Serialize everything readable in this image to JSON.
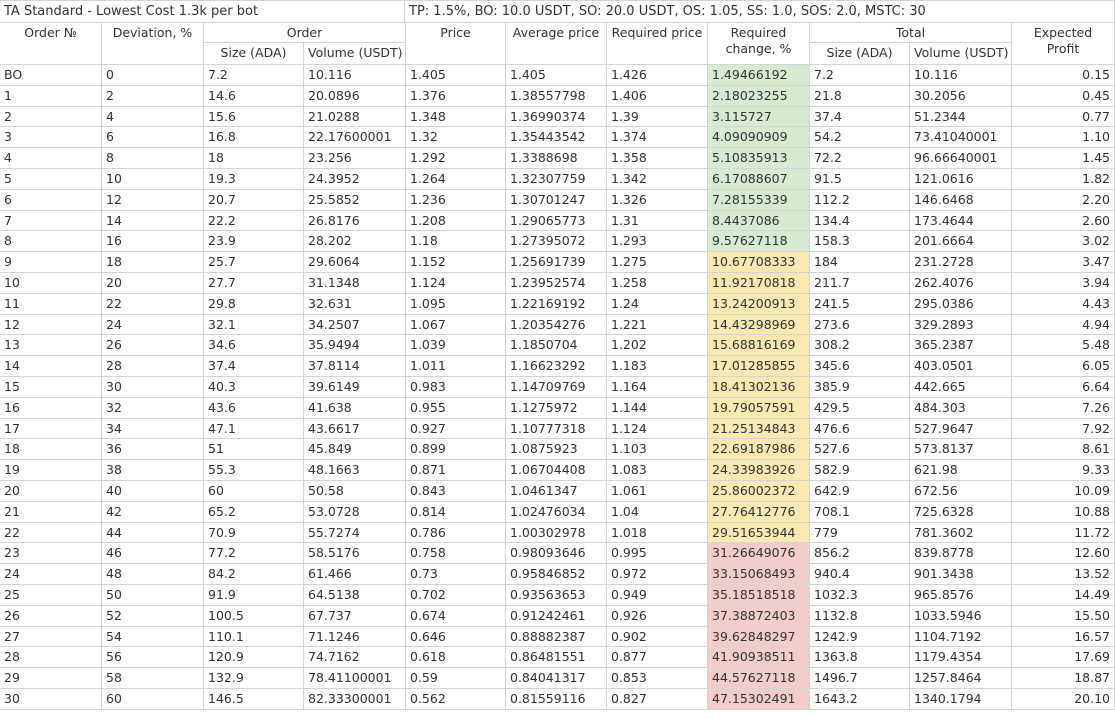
{
  "title_left": "TA Standard - Lowest Cost 1.3k per bot",
  "title_right": "TP: 1.5%, BO: 10.0 USDT, SO: 20.0 USDT, OS: 1.05, SS: 1.0, SOS: 2.0, MSTC: 30",
  "headers": {
    "order_no": "Order №",
    "deviation": "Deviation, %",
    "order": "Order",
    "price": "Price",
    "avg_price": "Average price",
    "req_price": "Required price",
    "req_change": "Required change, %",
    "total": "Total",
    "expected": "Expected Profit",
    "size": "Size (ADA)",
    "volume": "Volume (USDT)",
    "tsize": "Size (ADA)",
    "tvolume": "Volume (USDT)"
  },
  "rows": [
    {
      "n": "BO",
      "dev": "0",
      "size": "7.2",
      "vol": "10.116",
      "price": "1.405",
      "avg": "1.405",
      "req": "1.426",
      "chg": "1.49466192",
      "tsize": "7.2",
      "tvol": "10.116",
      "profit": "0.15",
      "color": "green"
    },
    {
      "n": "1",
      "dev": "2",
      "size": "14.6",
      "vol": "20.0896",
      "price": "1.376",
      "avg": "1.38557798",
      "req": "1.406",
      "chg": "2.18023255",
      "tsize": "21.8",
      "tvol": "30.2056",
      "profit": "0.45",
      "color": "green"
    },
    {
      "n": "2",
      "dev": "4",
      "size": "15.6",
      "vol": "21.0288",
      "price": "1.348",
      "avg": "1.36990374",
      "req": "1.39",
      "chg": "3.115727",
      "tsize": "37.4",
      "tvol": "51.2344",
      "profit": "0.77",
      "color": "green"
    },
    {
      "n": "3",
      "dev": "6",
      "size": "16.8",
      "vol": "22.17600001",
      "price": "1.32",
      "avg": "1.35443542",
      "req": "1.374",
      "chg": "4.09090909",
      "tsize": "54.2",
      "tvol": "73.41040001",
      "profit": "1.10",
      "color": "green"
    },
    {
      "n": "4",
      "dev": "8",
      "size": "18",
      "vol": "23.256",
      "price": "1.292",
      "avg": "1.3388698",
      "req": "1.358",
      "chg": "5.10835913",
      "tsize": "72.2",
      "tvol": "96.66640001",
      "profit": "1.45",
      "color": "green"
    },
    {
      "n": "5",
      "dev": "10",
      "size": "19.3",
      "vol": "24.3952",
      "price": "1.264",
      "avg": "1.32307759",
      "req": "1.342",
      "chg": "6.17088607",
      "tsize": "91.5",
      "tvol": "121.0616",
      "profit": "1.82",
      "color": "green"
    },
    {
      "n": "6",
      "dev": "12",
      "size": "20.7",
      "vol": "25.5852",
      "price": "1.236",
      "avg": "1.30701247",
      "req": "1.326",
      "chg": "7.28155339",
      "tsize": "112.2",
      "tvol": "146.6468",
      "profit": "2.20",
      "color": "green"
    },
    {
      "n": "7",
      "dev": "14",
      "size": "22.2",
      "vol": "26.8176",
      "price": "1.208",
      "avg": "1.29065773",
      "req": "1.31",
      "chg": "8.4437086",
      "tsize": "134.4",
      "tvol": "173.4644",
      "profit": "2.60",
      "color": "green"
    },
    {
      "n": "8",
      "dev": "16",
      "size": "23.9",
      "vol": "28.202",
      "price": "1.18",
      "avg": "1.27395072",
      "req": "1.293",
      "chg": "9.57627118",
      "tsize": "158.3",
      "tvol": "201.6664",
      "profit": "3.02",
      "color": "green"
    },
    {
      "n": "9",
      "dev": "18",
      "size": "25.7",
      "vol": "29.6064",
      "price": "1.152",
      "avg": "1.25691739",
      "req": "1.275",
      "chg": "10.67708333",
      "tsize": "184",
      "tvol": "231.2728",
      "profit": "3.47",
      "color": "yellow"
    },
    {
      "n": "10",
      "dev": "20",
      "size": "27.7",
      "vol": "31.1348",
      "price": "1.124",
      "avg": "1.23952574",
      "req": "1.258",
      "chg": "11.92170818",
      "tsize": "211.7",
      "tvol": "262.4076",
      "profit": "3.94",
      "color": "yellow"
    },
    {
      "n": "11",
      "dev": "22",
      "size": "29.8",
      "vol": "32.631",
      "price": "1.095",
      "avg": "1.22169192",
      "req": "1.24",
      "chg": "13.24200913",
      "tsize": "241.5",
      "tvol": "295.0386",
      "profit": "4.43",
      "color": "yellow"
    },
    {
      "n": "12",
      "dev": "24",
      "size": "32.1",
      "vol": "34.2507",
      "price": "1.067",
      "avg": "1.20354276",
      "req": "1.221",
      "chg": "14.43298969",
      "tsize": "273.6",
      "tvol": "329.2893",
      "profit": "4.94",
      "color": "yellow"
    },
    {
      "n": "13",
      "dev": "26",
      "size": "34.6",
      "vol": "35.9494",
      "price": "1.039",
      "avg": "1.1850704",
      "req": "1.202",
      "chg": "15.68816169",
      "tsize": "308.2",
      "tvol": "365.2387",
      "profit": "5.48",
      "color": "yellow"
    },
    {
      "n": "14",
      "dev": "28",
      "size": "37.4",
      "vol": "37.8114",
      "price": "1.011",
      "avg": "1.16623292",
      "req": "1.183",
      "chg": "17.01285855",
      "tsize": "345.6",
      "tvol": "403.0501",
      "profit": "6.05",
      "color": "yellow"
    },
    {
      "n": "15",
      "dev": "30",
      "size": "40.3",
      "vol": "39.6149",
      "price": "0.983",
      "avg": "1.14709769",
      "req": "1.164",
      "chg": "18.41302136",
      "tsize": "385.9",
      "tvol": "442.665",
      "profit": "6.64",
      "color": "yellow"
    },
    {
      "n": "16",
      "dev": "32",
      "size": "43.6",
      "vol": "41.638",
      "price": "0.955",
      "avg": "1.1275972",
      "req": "1.144",
      "chg": "19.79057591",
      "tsize": "429.5",
      "tvol": "484.303",
      "profit": "7.26",
      "color": "yellow"
    },
    {
      "n": "17",
      "dev": "34",
      "size": "47.1",
      "vol": "43.6617",
      "price": "0.927",
      "avg": "1.10777318",
      "req": "1.124",
      "chg": "21.25134843",
      "tsize": "476.6",
      "tvol": "527.9647",
      "profit": "7.92",
      "color": "yellow"
    },
    {
      "n": "18",
      "dev": "36",
      "size": "51",
      "vol": "45.849",
      "price": "0.899",
      "avg": "1.0875923",
      "req": "1.103",
      "chg": "22.69187986",
      "tsize": "527.6",
      "tvol": "573.8137",
      "profit": "8.61",
      "color": "yellow"
    },
    {
      "n": "19",
      "dev": "38",
      "size": "55.3",
      "vol": "48.1663",
      "price": "0.871",
      "avg": "1.06704408",
      "req": "1.083",
      "chg": "24.33983926",
      "tsize": "582.9",
      "tvol": "621.98",
      "profit": "9.33",
      "color": "yellow"
    },
    {
      "n": "20",
      "dev": "40",
      "size": "60",
      "vol": "50.58",
      "price": "0.843",
      "avg": "1.0461347",
      "req": "1.061",
      "chg": "25.86002372",
      "tsize": "642.9",
      "tvol": "672.56",
      "profit": "10.09",
      "color": "yellow"
    },
    {
      "n": "21",
      "dev": "42",
      "size": "65.2",
      "vol": "53.0728",
      "price": "0.814",
      "avg": "1.02476034",
      "req": "1.04",
      "chg": "27.76412776",
      "tsize": "708.1",
      "tvol": "725.6328",
      "profit": "10.88",
      "color": "yellow"
    },
    {
      "n": "22",
      "dev": "44",
      "size": "70.9",
      "vol": "55.7274",
      "price": "0.786",
      "avg": "1.00302978",
      "req": "1.018",
      "chg": "29.51653944",
      "tsize": "779",
      "tvol": "781.3602",
      "profit": "11.72",
      "color": "yellow"
    },
    {
      "n": "23",
      "dev": "46",
      "size": "77.2",
      "vol": "58.5176",
      "price": "0.758",
      "avg": "0.98093646",
      "req": "0.995",
      "chg": "31.26649076",
      "tsize": "856.2",
      "tvol": "839.8778",
      "profit": "12.60",
      "color": "red"
    },
    {
      "n": "24",
      "dev": "48",
      "size": "84.2",
      "vol": "61.466",
      "price": "0.73",
      "avg": "0.95846852",
      "req": "0.972",
      "chg": "33.15068493",
      "tsize": "940.4",
      "tvol": "901.3438",
      "profit": "13.52",
      "color": "red"
    },
    {
      "n": "25",
      "dev": "50",
      "size": "91.9",
      "vol": "64.5138",
      "price": "0.702",
      "avg": "0.93563653",
      "req": "0.949",
      "chg": "35.18518518",
      "tsize": "1032.3",
      "tvol": "965.8576",
      "profit": "14.49",
      "color": "red"
    },
    {
      "n": "26",
      "dev": "52",
      "size": "100.5",
      "vol": "67.737",
      "price": "0.674",
      "avg": "0.91242461",
      "req": "0.926",
      "chg": "37.38872403",
      "tsize": "1132.8",
      "tvol": "1033.5946",
      "profit": "15.50",
      "color": "red"
    },
    {
      "n": "27",
      "dev": "54",
      "size": "110.1",
      "vol": "71.1246",
      "price": "0.646",
      "avg": "0.88882387",
      "req": "0.902",
      "chg": "39.62848297",
      "tsize": "1242.9",
      "tvol": "1104.7192",
      "profit": "16.57",
      "color": "red"
    },
    {
      "n": "28",
      "dev": "56",
      "size": "120.9",
      "vol": "74.7162",
      "price": "0.618",
      "avg": "0.86481551",
      "req": "0.877",
      "chg": "41.90938511",
      "tsize": "1363.8",
      "tvol": "1179.4354",
      "profit": "17.69",
      "color": "red"
    },
    {
      "n": "29",
      "dev": "58",
      "size": "132.9",
      "vol": "78.41100001",
      "price": "0.59",
      "avg": "0.84041317",
      "req": "0.853",
      "chg": "44.57627118",
      "tsize": "1496.7",
      "tvol": "1257.8464",
      "profit": "18.87",
      "color": "red"
    },
    {
      "n": "30",
      "dev": "60",
      "size": "146.5",
      "vol": "82.33300001",
      "price": "0.562",
      "avg": "0.81559116",
      "req": "0.827",
      "chg": "47.15302491",
      "tsize": "1643.2",
      "tvol": "1340.1794",
      "profit": "20.10",
      "color": "red"
    }
  ]
}
